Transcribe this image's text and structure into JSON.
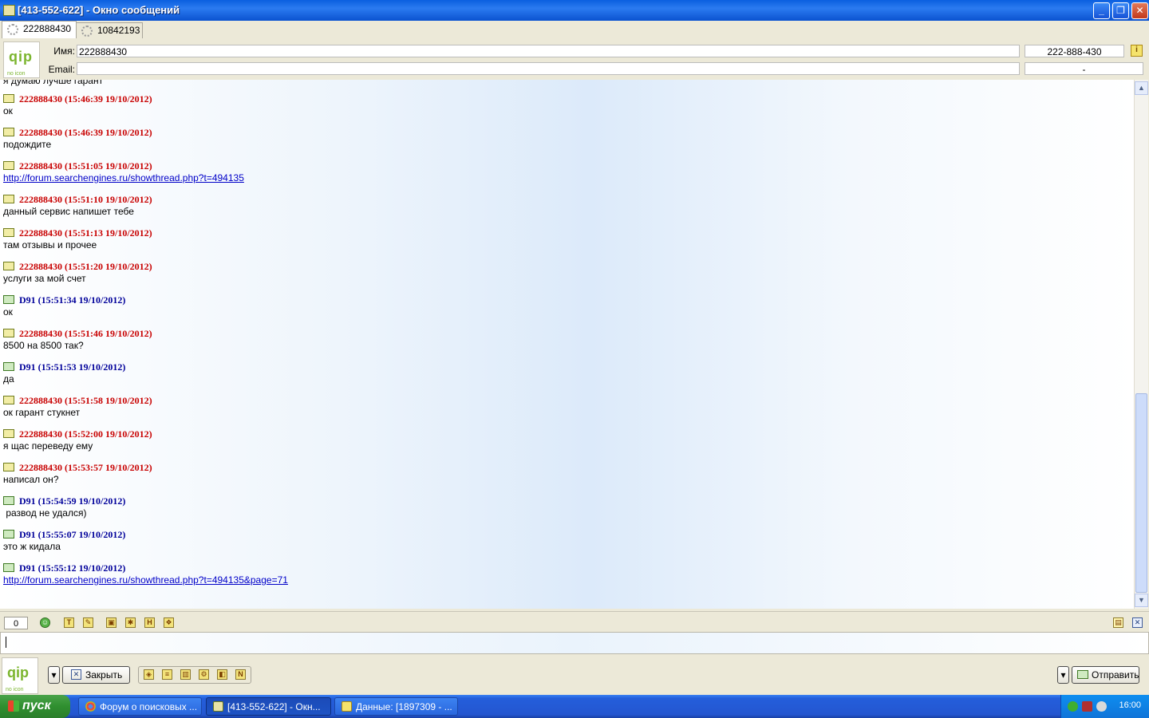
{
  "window": {
    "title": "[413-552-622] - Окно сообщений",
    "min_glyph": "_",
    "max_glyph": "❐",
    "close_glyph": "✕"
  },
  "tabs": [
    {
      "label": "222888430",
      "active": true
    },
    {
      "label": "10842193",
      "active": false
    }
  ],
  "header": {
    "logo_text": "qip",
    "logo_sub": "no icon",
    "name_label": "Имя:",
    "name_value": "222888430",
    "uin_value": "222-888-430",
    "email_label": "Email:",
    "email_value": "",
    "status_value": "-",
    "info_glyph": "i"
  },
  "chat": {
    "cut_line": "я думаю лучше гарант",
    "messages": [
      {
        "nick": "222888430",
        "time": "(15:46:39 19/10/2012)",
        "text": "ок",
        "own": false,
        "link": false
      },
      {
        "nick": "222888430",
        "time": "(15:46:39 19/10/2012)",
        "text": "подождите",
        "own": false,
        "link": false
      },
      {
        "nick": "222888430",
        "time": "(15:51:05 19/10/2012)",
        "text": "http://forum.searchengines.ru/showthread.php?t=494135",
        "own": false,
        "link": true
      },
      {
        "nick": "222888430",
        "time": "(15:51:10 19/10/2012)",
        "text": "данный сервис напишет тебе",
        "own": false,
        "link": false
      },
      {
        "nick": "222888430",
        "time": "(15:51:13 19/10/2012)",
        "text": "там отзывы и прочее",
        "own": false,
        "link": false
      },
      {
        "nick": "222888430",
        "time": "(15:51:20 19/10/2012)",
        "text": "услуги за мой счет",
        "own": false,
        "link": false
      },
      {
        "nick": "D91",
        "time": "(15:51:34 19/10/2012)",
        "text": "ок",
        "own": true,
        "link": false
      },
      {
        "nick": "222888430",
        "time": "(15:51:46 19/10/2012)",
        "text": "8500 на 8500 так?",
        "own": false,
        "link": false
      },
      {
        "nick": "D91",
        "time": "(15:51:53 19/10/2012)",
        "text": "да",
        "own": true,
        "link": false
      },
      {
        "nick": "222888430",
        "time": "(15:51:58 19/10/2012)",
        "text": "ок гарант стукнет",
        "own": false,
        "link": false
      },
      {
        "nick": "222888430",
        "time": "(15:52:00 19/10/2012)",
        "text": "я щас переведу ему",
        "own": false,
        "link": false
      },
      {
        "nick": "222888430",
        "time": "(15:53:57 19/10/2012)",
        "text": "написал он?",
        "own": false,
        "link": false
      },
      {
        "nick": "D91",
        "time": "(15:54:59 19/10/2012)",
        "text": " развод не удался)",
        "own": true,
        "link": false
      },
      {
        "nick": "D91",
        "time": "(15:55:07 19/10/2012)",
        "text": "это ж кидала",
        "own": true,
        "link": false
      },
      {
        "nick": "D91",
        "time": "(15:55:12 19/10/2012)",
        "text": "http://forum.searchengines.ru/showthread.php?t=494135&page=71",
        "own": true,
        "link": true
      }
    ],
    "scroll_position": 0.82
  },
  "toolbar": {
    "counter": "0",
    "icons": [
      "smile-icon",
      "font-icon",
      "color-icon",
      "save-icon",
      "image-icon",
      "history-icon",
      "quote-icon"
    ],
    "icon_glyphs": [
      "☺",
      "T",
      "✎",
      "▣",
      "✱",
      "H",
      "❖"
    ],
    "note_glyph": "▤",
    "clear_glyph": "✕"
  },
  "input": {
    "value": ""
  },
  "bottom": {
    "dropdown_glyph": "▾",
    "close_label": "Закрыть",
    "close_glyph": "✕",
    "send_label": "Отправить",
    "send_dropdown_glyph": "▾",
    "action_glyphs": [
      "◈",
      "≡",
      "▥",
      "⚙",
      "◧",
      "N"
    ]
  },
  "taskbar": {
    "start_label": "пуск",
    "tasks": [
      {
        "label": "Форум о поисковых ...",
        "active": false
      },
      {
        "label": "[413-552-622] - Окн...",
        "active": true
      },
      {
        "label": "Данные: [1897309 - ...",
        "active": false
      }
    ],
    "clock": "16:00"
  },
  "colors": {
    "peer_nick": "#c80000",
    "own_nick": "#00009a",
    "link": "#0000c8"
  }
}
